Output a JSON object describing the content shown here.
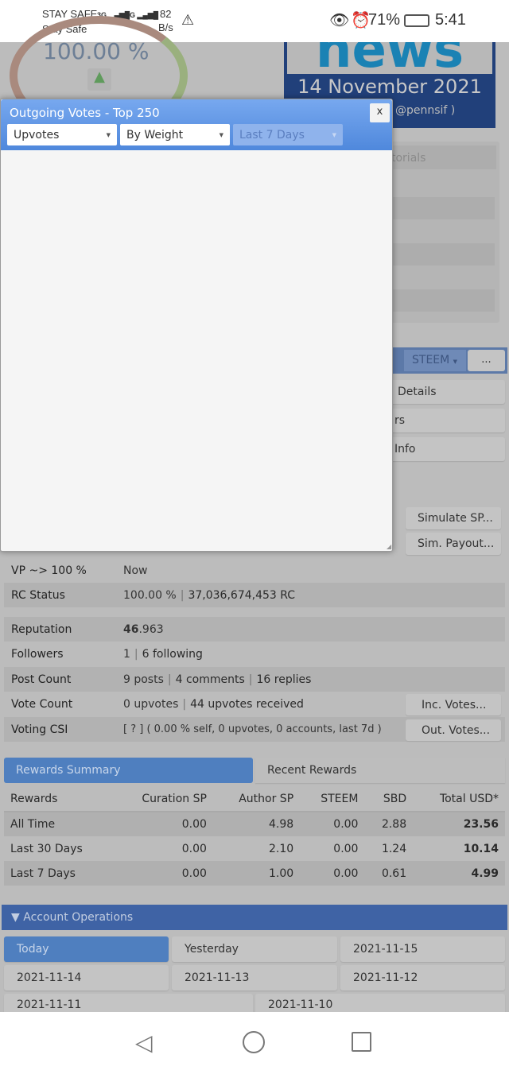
{
  "status_bar": {
    "carrier1": "STAY SAFE",
    "carrier2": "Stay Safe",
    "net1": "3G",
    "net2": "4G",
    "speed_value": "82",
    "speed_unit": "B/s",
    "battery": "71%",
    "time": "5:41"
  },
  "background": {
    "gauge_value": "100.00 %",
    "banner_word": "news",
    "banner_date": "14 November 2021",
    "banner_author": "@pennsif )",
    "tutorials_tab": "torials",
    "currency_select": "STEEM",
    "more_button": "...",
    "menu_items": [
      "Details",
      "rs",
      "Info"
    ],
    "simulate_sp": "Simulate SP...",
    "sim_payout": "Sim. Payout..."
  },
  "dialog": {
    "title": "Outgoing Votes - Top 250",
    "close": "x",
    "type_select": "Upvotes",
    "sort_select": "By Weight",
    "period_select": "Last 7 Days"
  },
  "stats": [
    {
      "label": "VP ~> 100 %",
      "value": "Now"
    },
    {
      "label": "RC Status",
      "value": "100.00 %",
      "value2": "37,036,674,453 RC"
    },
    {
      "label": "Reputation",
      "value_bold": "46",
      "value": ".963"
    },
    {
      "label": "Followers",
      "value": "1",
      "value2": "6 following"
    },
    {
      "label": "Post Count",
      "value": "9 posts",
      "value2": "4 comments",
      "value3": "16 replies"
    },
    {
      "label": "Vote Count",
      "value": "0 upvotes",
      "value2": "44 upvotes received",
      "button": "Inc. Votes..."
    },
    {
      "label": "Voting CSI",
      "value": "[ ? ] ( 0.00 % self, 0 upvotes, 0 accounts, last 7d )",
      "button": "Out. Votes..."
    }
  ],
  "rewards": {
    "tabs": [
      "Rewards Summary",
      "Recent Rewards"
    ],
    "headers": [
      "Rewards",
      "Curation SP",
      "Author SP",
      "STEEM",
      "SBD",
      "Total USD*"
    ],
    "rows": [
      [
        "All Time",
        "0.00",
        "4.98",
        "0.00",
        "2.88",
        "23.56"
      ],
      [
        "Last 30 Days",
        "0.00",
        "2.10",
        "0.00",
        "1.24",
        "10.14"
      ],
      [
        "Last 7 Days",
        "0.00",
        "1.00",
        "0.00",
        "0.61",
        "4.99"
      ]
    ]
  },
  "operations": {
    "title": "Account Operations",
    "days": [
      "Today",
      "Yesterday",
      "2021-11-15",
      "2021-11-14",
      "2021-11-13",
      "2021-11-12",
      "2021-11-11",
      "2021-11-10"
    ]
  },
  "colors": {
    "accent": "#5b93e0",
    "dialog_body": "#f5f5f5",
    "page": "#bcbcbc"
  }
}
